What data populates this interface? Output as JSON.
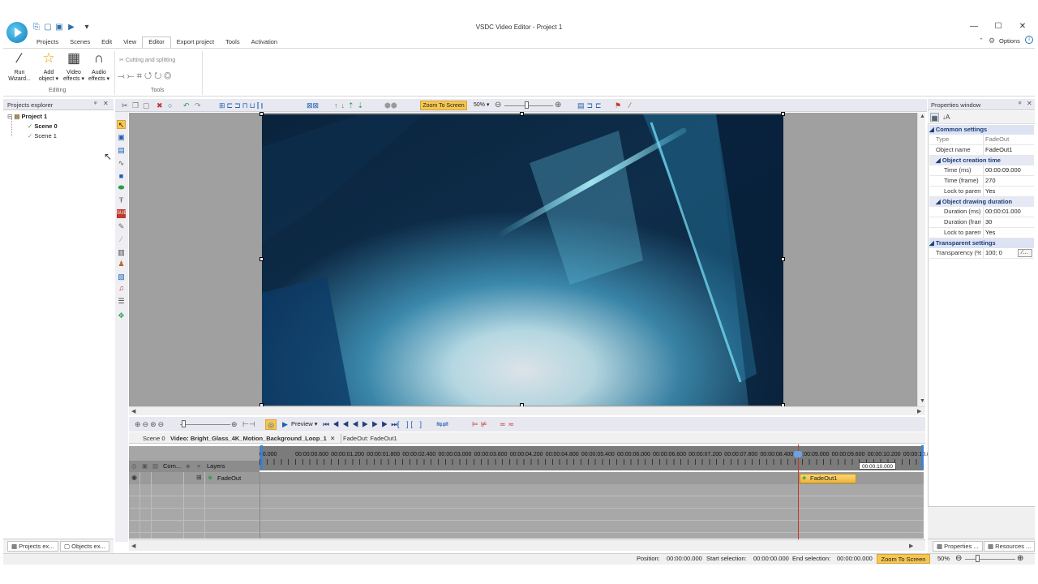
{
  "window": {
    "title": "VSDC Video Editor - Project 1",
    "minimize": "—",
    "maximize": "☐",
    "close": "✕",
    "options_label": "Options",
    "caret": "⌃"
  },
  "quick_access": [
    "save-all-icon",
    "open-icon",
    "save-icon",
    "play-icon",
    "dropdown-icon"
  ],
  "menu": [
    {
      "label": "Projects"
    },
    {
      "label": "Scenes"
    },
    {
      "label": "Edit"
    },
    {
      "label": "View"
    },
    {
      "label": "Editor",
      "active": true
    },
    {
      "label": "Export project"
    },
    {
      "label": "Tools"
    },
    {
      "label": "Activation"
    }
  ],
  "ribbon": {
    "run_wizard": "Run\nWizard...",
    "run_wizard_l1": "Run",
    "run_wizard_l2": "Wizard...",
    "add_object_l1": "Add",
    "add_object_l2": "object ▾",
    "video_effects_l1": "Video",
    "video_effects_l2": "effects ▾",
    "audio_effects_l1": "Audio",
    "audio_effects_l2": "effects ▾",
    "group_editing": "Editing",
    "cutting_splitting": "Cutting and splitting",
    "group_tools": "Tools"
  },
  "projects_explorer": {
    "title": "Projects explorer",
    "pin": "ᵠ",
    "close": "✕",
    "tree": {
      "project": "Project 1",
      "scene0": "Scene 0",
      "scene1": "Scene 1"
    },
    "tabs": [
      "Projects ex...",
      "Objects ex..."
    ]
  },
  "toolbar": {
    "zoom_to_screen": "Zoom To Screen",
    "zoom_percent": "50% ▾"
  },
  "timeline": {
    "preview": "Preview ▾",
    "tabs": [
      "Scene 0",
      "Video: Bright_Glass_4K_Motion_Background_Loop_1",
      "FadeOut: FadeOut1"
    ],
    "tab_close": "✕",
    "ruler_labels": [
      "00.000",
      "00:00:00.600",
      "00:00:01.200",
      "00:00:01.800",
      "00:00:02.400",
      "00:00:03.000",
      "00:00:03.600",
      "00:00:04.200",
      "00:00:04.800",
      "00:00:05.400",
      "00:00:06.000",
      "00:00:06.600",
      "00:00:07.200",
      "00:00:07.800",
      "00:00:08.400",
      "00:00:09.000",
      "00:00:09.600",
      "00:00:10.200",
      "00:00:10.800"
    ],
    "header_com": "Com...",
    "header_layers": "Layers",
    "layer_name": "FadeOut",
    "clip_label": "FadeOut1",
    "end_time": "00:00:10.000"
  },
  "properties": {
    "title": "Properties window",
    "pin": "ᵠ",
    "close": "✕",
    "common_settings": "Common settings",
    "type_k": "Type",
    "type_v": "FadeOut",
    "name_k": "Object name",
    "name_v": "FadeOut1",
    "creation_time": "Object creation time",
    "time_ms_k": "Time (ms)",
    "time_ms_v": "00:00:09.000",
    "time_frame_k": "Time (frame)",
    "time_frame_v": "270",
    "lock1_k": "Lock to parent",
    "lock1_v": "Yes",
    "drawing_duration": "Object drawing duration",
    "dur_ms_k": "Duration (ms)",
    "dur_ms_v": "00:00:01.000",
    "dur_fr_k": "Duration (frames)",
    "dur_fr_v": "30",
    "lock2_k": "Lock to parent",
    "lock2_v": "Yes",
    "transparent_settings": "Transparent settings",
    "transp_k": "Transparency (%)",
    "transp_v": "100; 0",
    "tabs": [
      "Properties ...",
      "Resources ..."
    ]
  },
  "status": {
    "position_label": "Position:",
    "position_value": "00:00:00.000",
    "start_label": "Start selection:",
    "start_value": "00:00:00.000",
    "end_label": "End selection:",
    "end_value": "00:00:00.000",
    "zoom_to_screen": "Zoom To Screen",
    "zoom_percent": "50%"
  }
}
